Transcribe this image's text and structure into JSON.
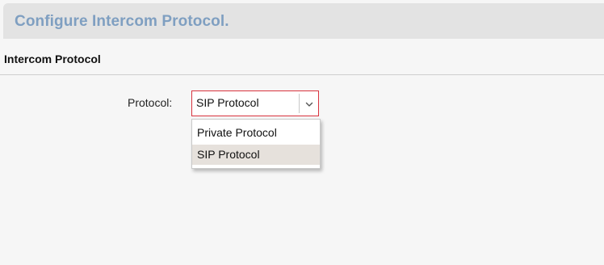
{
  "header": {
    "title": "Configure Intercom Protocol."
  },
  "section": {
    "title": "Intercom Protocol"
  },
  "form": {
    "protocol_label": "Protocol:",
    "protocol_select": {
      "value": "SIP Protocol",
      "options": [
        "Private Protocol",
        "SIP Protocol"
      ],
      "selected_index": 1,
      "icon": "chevron-down-icon"
    }
  },
  "colors": {
    "header_text": "#7f9fc1",
    "select_border": "#d9343f",
    "selected_option_bg": "#e6e1dc"
  }
}
